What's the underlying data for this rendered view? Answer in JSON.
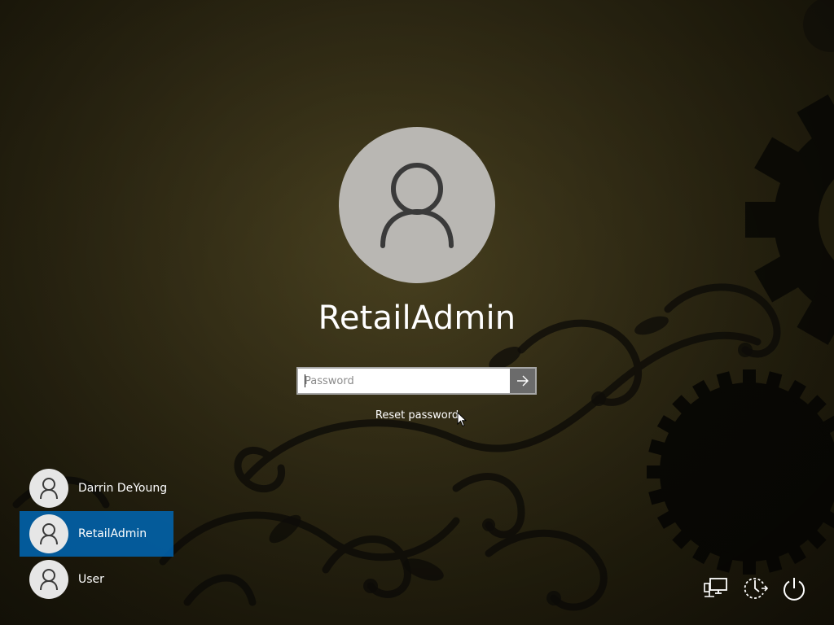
{
  "lock_screen": {
    "selected_user": {
      "name": "RetailAdmin",
      "avatar_icon": "person-icon"
    },
    "password_field": {
      "placeholder": "Password",
      "value": ""
    },
    "submit_icon": "arrow-right-icon",
    "reset_password_label": "Reset password"
  },
  "user_list": [
    {
      "name": "Darrin DeYoung",
      "avatar_icon": "person-icon",
      "selected": false
    },
    {
      "name": "RetailAdmin",
      "avatar_icon": "person-icon",
      "selected": true
    },
    {
      "name": "User",
      "avatar_icon": "person-icon",
      "selected": false
    }
  ],
  "corner_actions": [
    {
      "icon": "network-icon"
    },
    {
      "icon": "ease-of-access-icon"
    },
    {
      "icon": "power-icon"
    }
  ],
  "colors": {
    "background": "#3b3419",
    "selection": "#0066b4",
    "avatar_bg": "#b9b7b3",
    "submit_bg": "#6b6b6b"
  }
}
